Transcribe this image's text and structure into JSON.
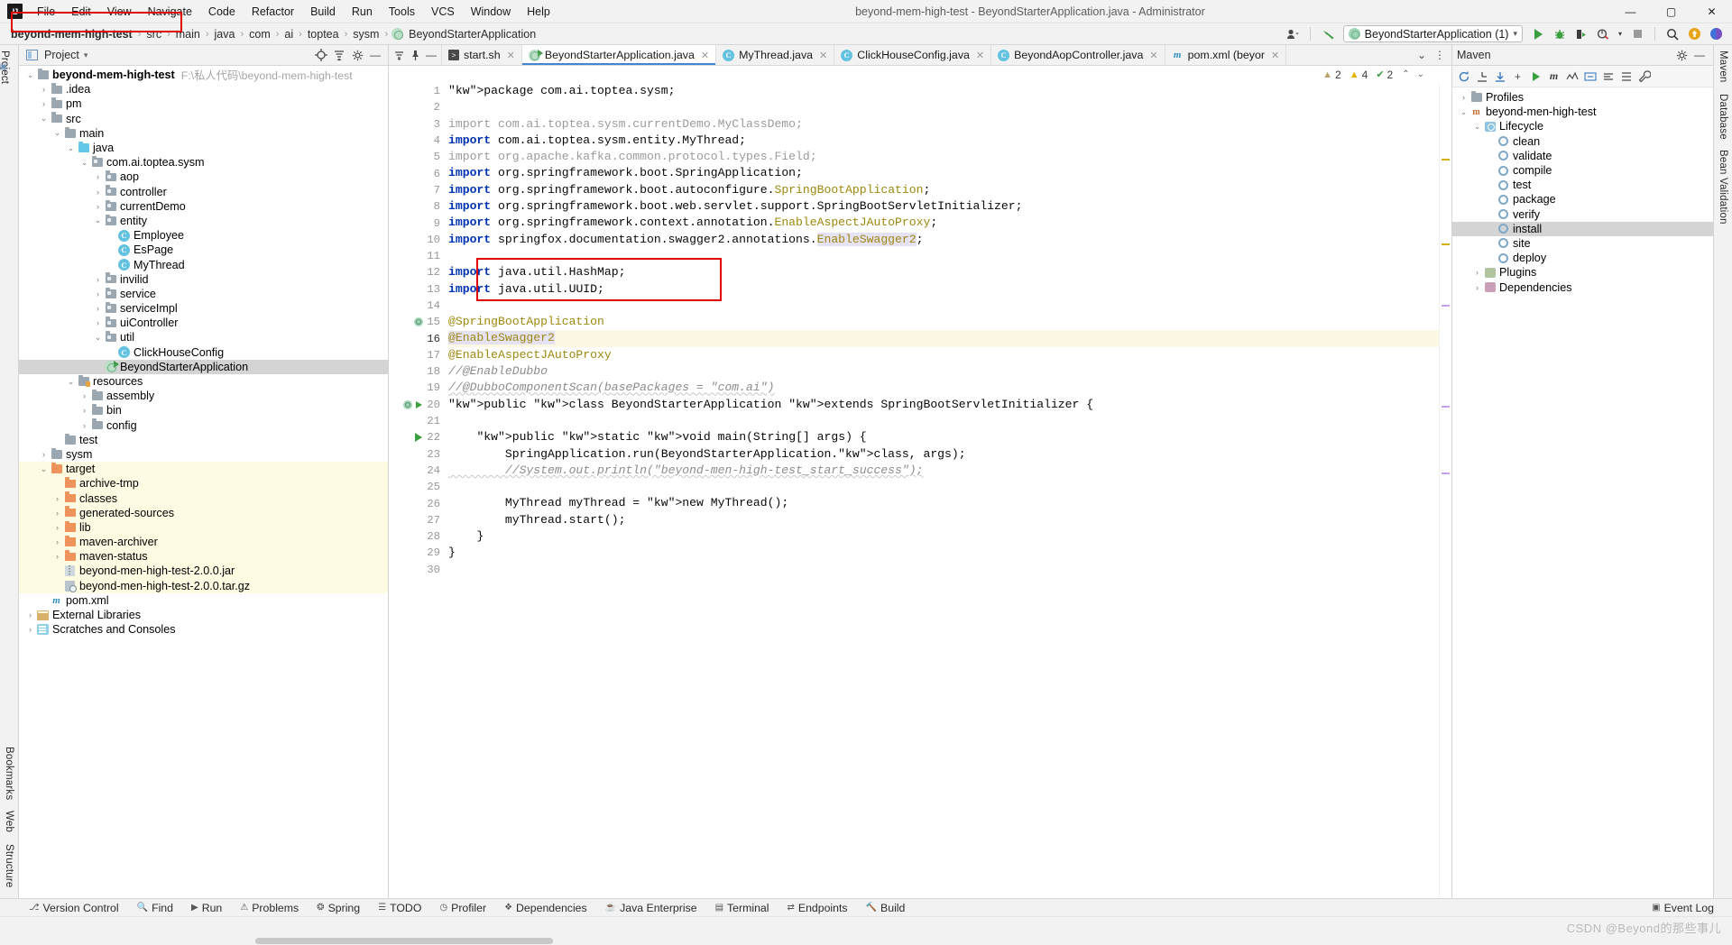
{
  "window": {
    "title": "beyond-mem-high-test - BeyondStarterApplication.java - Administrator",
    "logo": "IJ",
    "minimize": "—",
    "maximize": "▢",
    "close": "✕"
  },
  "menubar": [
    "File",
    "Edit",
    "View",
    "Navigate",
    "Code",
    "Refactor",
    "Build",
    "Run",
    "Tools",
    "VCS",
    "Window",
    "Help"
  ],
  "breadcrumb": {
    "root": "beyond-mem-high-test",
    "items": [
      "src",
      "main",
      "java",
      "com",
      "ai",
      "toptea",
      "sysm"
    ],
    "file": "BeyondStarterApplication",
    "separator": "›"
  },
  "toolbar": {
    "run_config": "BeyondStarterApplication (1)",
    "dropdown_caret": "▾",
    "user_icon": "user-icon",
    "build_icon": "hammer-icon",
    "run_label": "Run",
    "debug_label": "Debug",
    "coverage_label": "Run with Coverage",
    "profile_label": "Profiler",
    "stop_label": "Stop",
    "search_label": "Search Everywhere",
    "update_label": "Update Project",
    "settings_label": "Settings"
  },
  "left_rail": [
    "Project",
    "Structure",
    "Web",
    "Bookmarks"
  ],
  "right_rail": [
    "Maven",
    "Database",
    "Bean Validation"
  ],
  "project_panel": {
    "header": "Project",
    "locate_icon": "locate-icon",
    "collapse_icon": "collapse-all-icon",
    "settings_icon": "gear-icon",
    "hide_icon": "hide-icon",
    "root_label": "beyond-mem-high-test",
    "root_path": "F:\\私人代码\\beyond-mem-high-test",
    "tree": [
      {
        "depth": 0,
        "label": "beyond-mem-high-test",
        "path": "F:\\私人代码\\beyond-mem-high-test",
        "icon": "module",
        "arrow": "open",
        "bold": true
      },
      {
        "depth": 1,
        "label": ".idea",
        "icon": "folder-grey",
        "arrow": "closed"
      },
      {
        "depth": 1,
        "label": "pm",
        "icon": "folder-grey",
        "arrow": "closed"
      },
      {
        "depth": 1,
        "label": "src",
        "icon": "folder-grey",
        "arrow": "open"
      },
      {
        "depth": 2,
        "label": "main",
        "icon": "folder-grey",
        "arrow": "open"
      },
      {
        "depth": 3,
        "label": "java",
        "icon": "folder-blue",
        "arrow": "open"
      },
      {
        "depth": 4,
        "label": "com.ai.toptea.sysm",
        "icon": "package",
        "arrow": "open"
      },
      {
        "depth": 5,
        "label": "aop",
        "icon": "package",
        "arrow": "closed"
      },
      {
        "depth": 5,
        "label": "controller",
        "icon": "package",
        "arrow": "closed"
      },
      {
        "depth": 5,
        "label": "currentDemo",
        "icon": "package",
        "arrow": "closed"
      },
      {
        "depth": 5,
        "label": "entity",
        "icon": "package",
        "arrow": "open"
      },
      {
        "depth": 6,
        "label": "Employee",
        "icon": "class",
        "arrow": "none"
      },
      {
        "depth": 6,
        "label": "EsPage",
        "icon": "class",
        "arrow": "none"
      },
      {
        "depth": 6,
        "label": "MyThread",
        "icon": "class",
        "arrow": "none"
      },
      {
        "depth": 5,
        "label": "invilid",
        "icon": "package",
        "arrow": "closed"
      },
      {
        "depth": 5,
        "label": "service",
        "icon": "package",
        "arrow": "closed"
      },
      {
        "depth": 5,
        "label": "serviceImpl",
        "icon": "package",
        "arrow": "closed"
      },
      {
        "depth": 5,
        "label": "uiController",
        "icon": "package",
        "arrow": "closed"
      },
      {
        "depth": 5,
        "label": "util",
        "icon": "package",
        "arrow": "open"
      },
      {
        "depth": 6,
        "label": "ClickHouseConfig",
        "icon": "class",
        "arrow": "none"
      },
      {
        "depth": 5,
        "label": "BeyondStarterApplication",
        "icon": "spring-run",
        "arrow": "none",
        "selected": true
      },
      {
        "depth": 3,
        "label": "resources",
        "icon": "resources",
        "arrow": "open"
      },
      {
        "depth": 4,
        "label": "assembly",
        "icon": "folder-grey",
        "arrow": "closed"
      },
      {
        "depth": 4,
        "label": "bin",
        "icon": "folder-grey",
        "arrow": "closed"
      },
      {
        "depth": 4,
        "label": "config",
        "icon": "folder-grey",
        "arrow": "closed"
      },
      {
        "depth": 2,
        "label": "test",
        "icon": "folder-grey",
        "arrow": "none"
      },
      {
        "depth": 1,
        "label": "sysm",
        "icon": "folder-grey",
        "arrow": "closed"
      },
      {
        "depth": 1,
        "label": "target",
        "icon": "folder-orange",
        "arrow": "open",
        "yellow": true
      },
      {
        "depth": 2,
        "label": "archive-tmp",
        "icon": "folder-orange",
        "arrow": "none",
        "yellow": true
      },
      {
        "depth": 2,
        "label": "classes",
        "icon": "folder-orange",
        "arrow": "closed",
        "yellow": true
      },
      {
        "depth": 2,
        "label": "generated-sources",
        "icon": "folder-orange",
        "arrow": "closed",
        "yellow": true
      },
      {
        "depth": 2,
        "label": "lib",
        "icon": "folder-orange",
        "arrow": "closed",
        "yellow": true
      },
      {
        "depth": 2,
        "label": "maven-archiver",
        "icon": "folder-orange",
        "arrow": "closed",
        "yellow": true
      },
      {
        "depth": 2,
        "label": "maven-status",
        "icon": "folder-orange",
        "arrow": "closed",
        "yellow": true
      },
      {
        "depth": 2,
        "label": "beyond-men-high-test-2.0.0.jar",
        "icon": "jar",
        "arrow": "none",
        "yellow": true
      },
      {
        "depth": 2,
        "label": "beyond-men-high-test-2.0.0.tar.gz",
        "icon": "targz",
        "arrow": "none",
        "yellow": true
      },
      {
        "depth": 1,
        "label": "pom.xml",
        "icon": "maven",
        "arrow": "none"
      },
      {
        "depth": 0,
        "label": "External Libraries",
        "icon": "library",
        "arrow": "closed"
      },
      {
        "depth": 0,
        "label": "Scratches and Consoles",
        "icon": "scratch",
        "arrow": "closed"
      }
    ]
  },
  "editor": {
    "tabs": [
      {
        "label": "start.sh",
        "icon": "shell-icon",
        "active": false
      },
      {
        "label": "BeyondStarterApplication.java",
        "icon": "spring-icon",
        "active": true
      },
      {
        "label": "MyThread.java",
        "icon": "class-icon",
        "active": false
      },
      {
        "label": "ClickHouseConfig.java",
        "icon": "class-icon",
        "active": false
      },
      {
        "label": "BeyondAopController.java",
        "icon": "class-icon",
        "active": false
      },
      {
        "label": "pom.xml (beyor",
        "icon": "maven-icon",
        "active": false
      }
    ],
    "tab_overflow": "⌄",
    "tab_menu": "⋮",
    "inspections": {
      "typo_count": "2",
      "warning_count": "4",
      "grammar_count": "2",
      "up": "⌃",
      "down": "⌄"
    },
    "lines": [
      {
        "n": 1,
        "text": "package com.ai.toptea.sysm;"
      },
      {
        "n": 2,
        "text": ""
      },
      {
        "n": 3,
        "text": "import com.ai.toptea.sysm.currentDemo.MyClassDemo;"
      },
      {
        "n": 4,
        "text": "import com.ai.toptea.sysm.entity.MyThread;"
      },
      {
        "n": 5,
        "text": "import org.apache.kafka.common.protocol.types.Field;"
      },
      {
        "n": 6,
        "text": "import org.springframework.boot.SpringApplication;"
      },
      {
        "n": 7,
        "text": "import org.springframework.boot.autoconfigure.SpringBootApplication;"
      },
      {
        "n": 8,
        "text": "import org.springframework.boot.web.servlet.support.SpringBootServletInitializer;"
      },
      {
        "n": 9,
        "text": "import org.springframework.context.annotation.EnableAspectJAutoProxy;"
      },
      {
        "n": 10,
        "text": "import springfox.documentation.swagger2.annotations.EnableSwagger2;"
      },
      {
        "n": 11,
        "text": ""
      },
      {
        "n": 12,
        "text": "import java.util.HashMap;"
      },
      {
        "n": 13,
        "text": "import java.util.UUID;"
      },
      {
        "n": 14,
        "text": ""
      },
      {
        "n": 15,
        "text": "@SpringBootApplication"
      },
      {
        "n": 16,
        "text": "@EnableSwagger2"
      },
      {
        "n": 17,
        "text": "@EnableAspectJAutoProxy"
      },
      {
        "n": 18,
        "text": "//@EnableDubbo"
      },
      {
        "n": 19,
        "text": "//@DubboComponentScan(basePackages = \"com.ai\")"
      },
      {
        "n": 20,
        "text": "public class BeyondStarterApplication extends SpringBootServletInitializer {"
      },
      {
        "n": 21,
        "text": ""
      },
      {
        "n": 22,
        "text": "    public static void main(String[] args) {"
      },
      {
        "n": 23,
        "text": "        SpringApplication.run(BeyondStarterApplication.class, args);"
      },
      {
        "n": 24,
        "text": "        //System.out.println(\"beyond-men-high-test_start_success\");"
      },
      {
        "n": 25,
        "text": ""
      },
      {
        "n": 26,
        "text": "        MyThread myThread = new MyThread();"
      },
      {
        "n": 27,
        "text": "        myThread.start();"
      },
      {
        "n": 28,
        "text": "    }"
      },
      {
        "n": 29,
        "text": "}"
      },
      {
        "n": 30,
        "text": ""
      }
    ]
  },
  "maven_panel": {
    "title": "Maven",
    "settings_icon": "gear-icon",
    "hide_icon": "hide-icon",
    "tools": [
      "reload-icon",
      "add-icon",
      "collapse-icon",
      "download-icon",
      "plus-icon",
      "run-maven-icon",
      "m-icon",
      "graph-icon",
      "filter-icon",
      "toggle-icon",
      "skip-tests-icon",
      "wrench-icon"
    ],
    "tree": [
      {
        "depth": 0,
        "label": "Profiles",
        "icon": "profiles",
        "arrow": "closed"
      },
      {
        "depth": 0,
        "label": "beyond-men-high-test",
        "icon": "mvn-project",
        "arrow": "open"
      },
      {
        "depth": 1,
        "label": "Lifecycle",
        "icon": "lifecycle",
        "arrow": "open"
      },
      {
        "depth": 2,
        "label": "clean",
        "icon": "goal",
        "arrow": "none"
      },
      {
        "depth": 2,
        "label": "validate",
        "icon": "goal",
        "arrow": "none"
      },
      {
        "depth": 2,
        "label": "compile",
        "icon": "goal",
        "arrow": "none"
      },
      {
        "depth": 2,
        "label": "test",
        "icon": "goal",
        "arrow": "none"
      },
      {
        "depth": 2,
        "label": "package",
        "icon": "goal",
        "arrow": "none"
      },
      {
        "depth": 2,
        "label": "verify",
        "icon": "goal",
        "arrow": "none"
      },
      {
        "depth": 2,
        "label": "install",
        "icon": "goal",
        "arrow": "none",
        "selected": true
      },
      {
        "depth": 2,
        "label": "site",
        "icon": "goal",
        "arrow": "none"
      },
      {
        "depth": 2,
        "label": "deploy",
        "icon": "goal",
        "arrow": "none"
      },
      {
        "depth": 1,
        "label": "Plugins",
        "icon": "plugins",
        "arrow": "closed"
      },
      {
        "depth": 1,
        "label": "Dependencies",
        "icon": "dependencies",
        "arrow": "closed"
      }
    ]
  },
  "toolwindow_bar": [
    {
      "label": "Version Control",
      "icon": "branch-icon"
    },
    {
      "label": "Find",
      "icon": "search-icon"
    },
    {
      "label": "Run",
      "icon": "run-icon"
    },
    {
      "label": "Problems",
      "icon": "problems-icon"
    },
    {
      "label": "Spring",
      "icon": "spring-icon"
    },
    {
      "label": "TODO",
      "icon": "todo-icon"
    },
    {
      "label": "Profiler",
      "icon": "profiler-icon"
    },
    {
      "label": "Dependencies",
      "icon": "dependencies-icon"
    },
    {
      "label": "Java Enterprise",
      "icon": "java-icon"
    },
    {
      "label": "Terminal",
      "icon": "terminal-icon"
    },
    {
      "label": "Endpoints",
      "icon": "endpoints-icon"
    },
    {
      "label": "Build",
      "icon": "build-icon"
    }
  ],
  "event_log": {
    "label": "Event Log",
    "icon": "bell-icon"
  },
  "statusbar": {
    "watermark": "CSDN @Beyond的那些事儿"
  },
  "colors": {
    "accent": "#4185d6",
    "keyword": "#0033b3",
    "comment": "#8c8c8c",
    "annotation": "#9e880d",
    "string": "#067d17",
    "target_highlight": "#fdfbe2",
    "selection": "#d4d4d4",
    "red_box": "#e00000",
    "folder_orange": "#f0925c",
    "folder_blue": "#62c7e8"
  }
}
